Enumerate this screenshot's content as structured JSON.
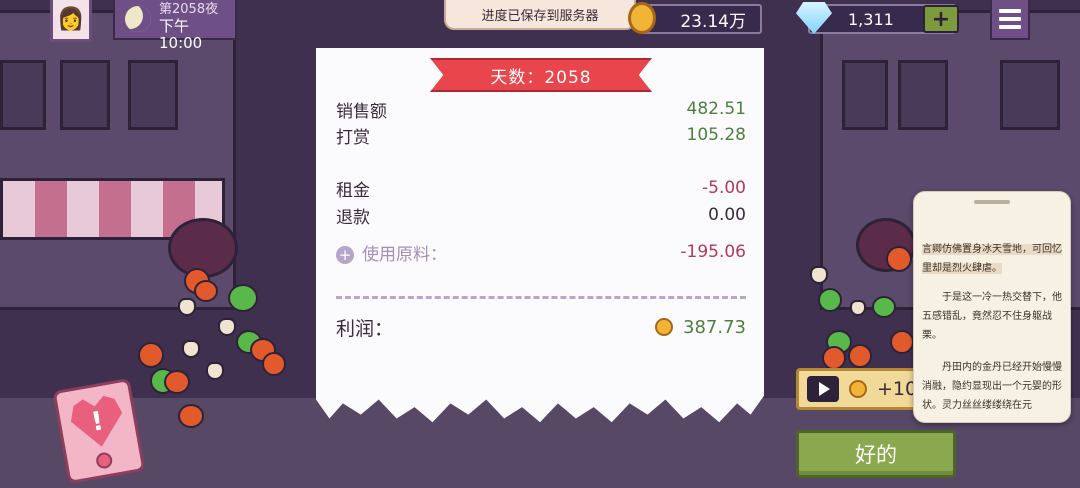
{
  "hud": {
    "day_label": "第2058夜",
    "time_label": "下午10:00",
    "save_toast": "进度已保存到服务器",
    "coins": "23.14万",
    "gems": "1,311",
    "gem_plus": "+"
  },
  "receipt": {
    "day_title": "天数：2058",
    "sales_label": "销售额",
    "sales_value": "482.51",
    "tips_label": "打赏",
    "tips_value": "105.28",
    "rent_label": "租金",
    "rent_value": "-5.00",
    "refund_label": "退款",
    "refund_value": "0.00",
    "material_label": "使用原料：",
    "material_value": "-195.06",
    "profit_label": "利润：",
    "profit_value": "387.73"
  },
  "reward": {
    "ad_reward": "+10"
  },
  "ok_button": "好的",
  "reader": {
    "para1": "言卿仿佛置身冰天雪地，可回忆里却是烈火肆虐。",
    "para2": "于是这一冷一热交替下，他五感错乱，竟然忍不住身躯战栗。",
    "para3": "丹田内的金丹已经开始慢慢消融，隐约显现出一个元婴的形状。灵力丝丝缕缕绕在元"
  }
}
